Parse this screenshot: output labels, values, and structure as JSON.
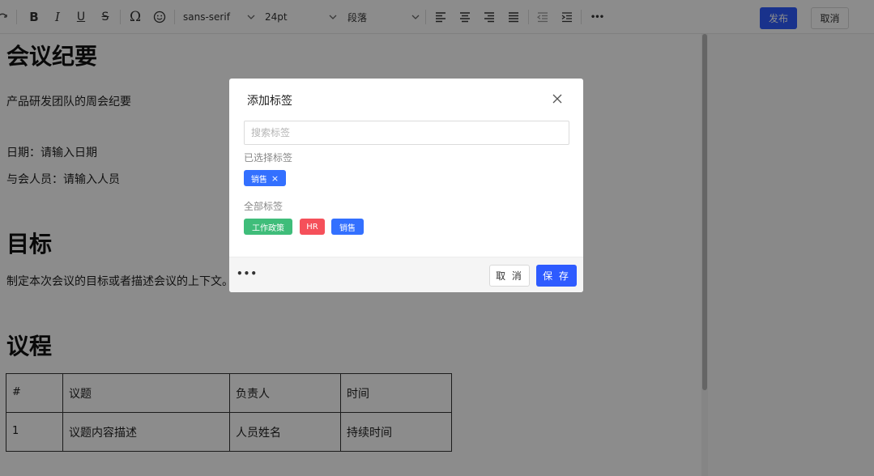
{
  "toolbar": {
    "font_family": "sans-serif",
    "font_size": "24pt",
    "paragraph_style": "段落",
    "publish_label": "发布",
    "cancel_label": "取消",
    "special_char_glyph": "Ω",
    "more_glyph": "•••"
  },
  "document": {
    "title": "会议纪要",
    "subtitle": "产品研发团队的周会纪要",
    "date_line": "日期：请输入日期",
    "attendees_line": "与会人员：请输入人员",
    "goal_heading": "目标",
    "goal_text": "制定本次会议的目标或者描述会议的上下文。",
    "agenda_heading": "议程",
    "table": {
      "headers": [
        "#",
        "议题",
        "负责人",
        "时间"
      ],
      "rows": [
        [
          "1",
          "议题内容描述",
          "人员姓名",
          "持续时间"
        ]
      ]
    }
  },
  "modal": {
    "title": "添加标签",
    "search_placeholder": "搜索标签",
    "search_value": "",
    "selected_label": "已选择标签",
    "selected_tags": [
      {
        "name": "销售",
        "color": "#3370ff"
      }
    ],
    "remove_glyph": "×",
    "all_label": "全部标签",
    "all_tags": [
      {
        "name": "工作政策",
        "color": "#3fbd7a"
      },
      {
        "name": "HR",
        "color": "#f5505a"
      },
      {
        "name": "销售",
        "color": "#3370ff"
      }
    ],
    "footer_more": "•••",
    "cancel_label": "取 消",
    "save_label": "保 存"
  },
  "colors": {
    "accent": "#2e5bff",
    "overlay": "rgba(0,0,0,0.45)"
  }
}
